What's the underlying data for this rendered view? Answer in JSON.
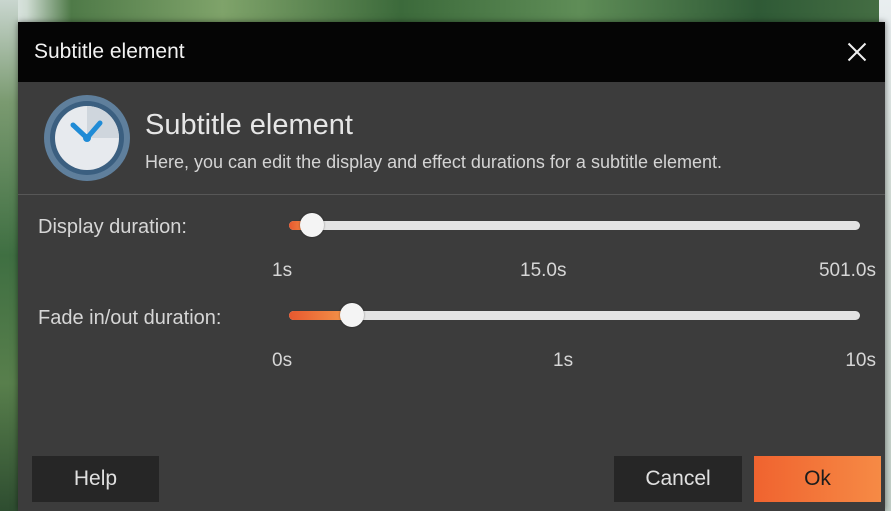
{
  "window": {
    "title": "Subtitle element"
  },
  "header": {
    "icon": "clock-icon",
    "title": "Subtitle element",
    "description": "Here, you can edit the display and effect durations for a subtitle element."
  },
  "display_duration": {
    "label": "Display duration:",
    "value_fraction": 0.04,
    "ticks": [
      "1s",
      "15.0s",
      "501.0s"
    ]
  },
  "fade_duration": {
    "label": "Fade in/out duration:",
    "value_fraction": 0.11,
    "ticks": [
      "0s",
      "1s",
      "10s"
    ]
  },
  "buttons": {
    "help": "Help",
    "cancel": "Cancel",
    "ok": "Ok"
  },
  "colors": {
    "accent": "#f0632f",
    "dialog_bg": "#3c3c3c",
    "titlebar_bg": "#050505"
  }
}
